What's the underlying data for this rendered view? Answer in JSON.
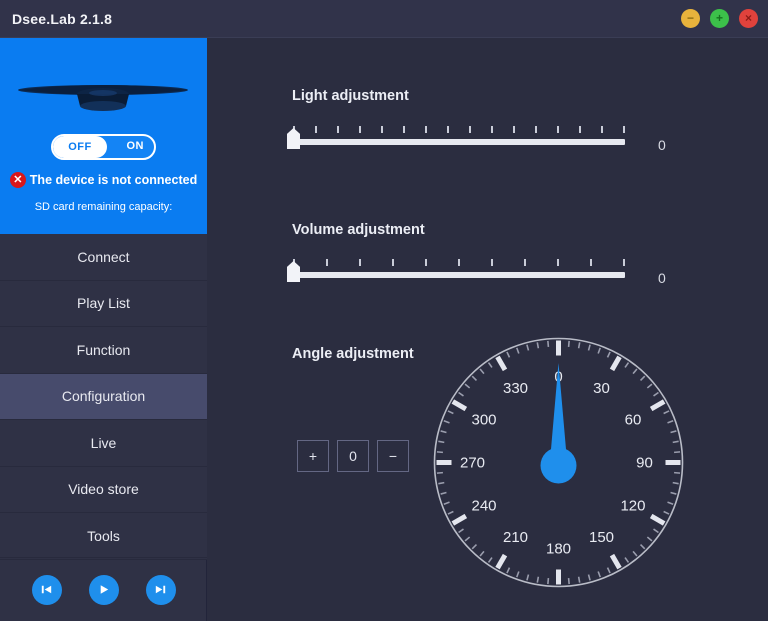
{
  "window": {
    "title": "Dsee.Lab 2.1.8",
    "controls": [
      {
        "name": "minimize",
        "glyph": "−",
        "color": "#e8b33c"
      },
      {
        "name": "maximize",
        "glyph": "+",
        "color": "#3cc04a"
      },
      {
        "name": "close",
        "glyph": "×",
        "color": "#e0423c"
      }
    ]
  },
  "sidebar": {
    "device": {
      "toggle": {
        "off_label": "OFF",
        "on_label": "ON",
        "state": "OFF"
      },
      "status_text": "The device is not connected",
      "status_icon": "error-x-icon",
      "sd_capacity_label": "SD card remaining capacity:",
      "panel_color": "#0a7cf1"
    },
    "items": [
      {
        "label": "Connect",
        "active": false
      },
      {
        "label": "Play List",
        "active": false
      },
      {
        "label": "Function",
        "active": false
      },
      {
        "label": "Configuration",
        "active": true
      },
      {
        "label": "Live",
        "active": false
      },
      {
        "label": "Video store",
        "active": false
      },
      {
        "label": "Tools",
        "active": false
      }
    ],
    "playback": [
      {
        "name": "previous-button",
        "icon": "skip-previous-icon"
      },
      {
        "name": "play-button",
        "icon": "play-icon"
      },
      {
        "name": "next-button",
        "icon": "skip-next-icon"
      }
    ],
    "accent_color": "#1f8fec"
  },
  "main": {
    "light": {
      "title": "Light adjustment",
      "value": "0",
      "min": 0,
      "max": 100,
      "tick_count": 16
    },
    "volume": {
      "title": "Volume adjustment",
      "value": "0",
      "min": 0,
      "max": 100,
      "tick_count": 11
    },
    "angle": {
      "title": "Angle adjustment",
      "increase_label": "+",
      "value": "0",
      "decrease_label": "−",
      "dial": {
        "needle_angle": 0,
        "needle_color": "#1f8fec",
        "major_labels": [
          "0",
          "30",
          "60",
          "90",
          "120",
          "150",
          "180",
          "210",
          "240",
          "270",
          "300",
          "330"
        ],
        "major_step": 30,
        "minor_step": 5,
        "ring_color": "#b9bcc7"
      }
    }
  }
}
